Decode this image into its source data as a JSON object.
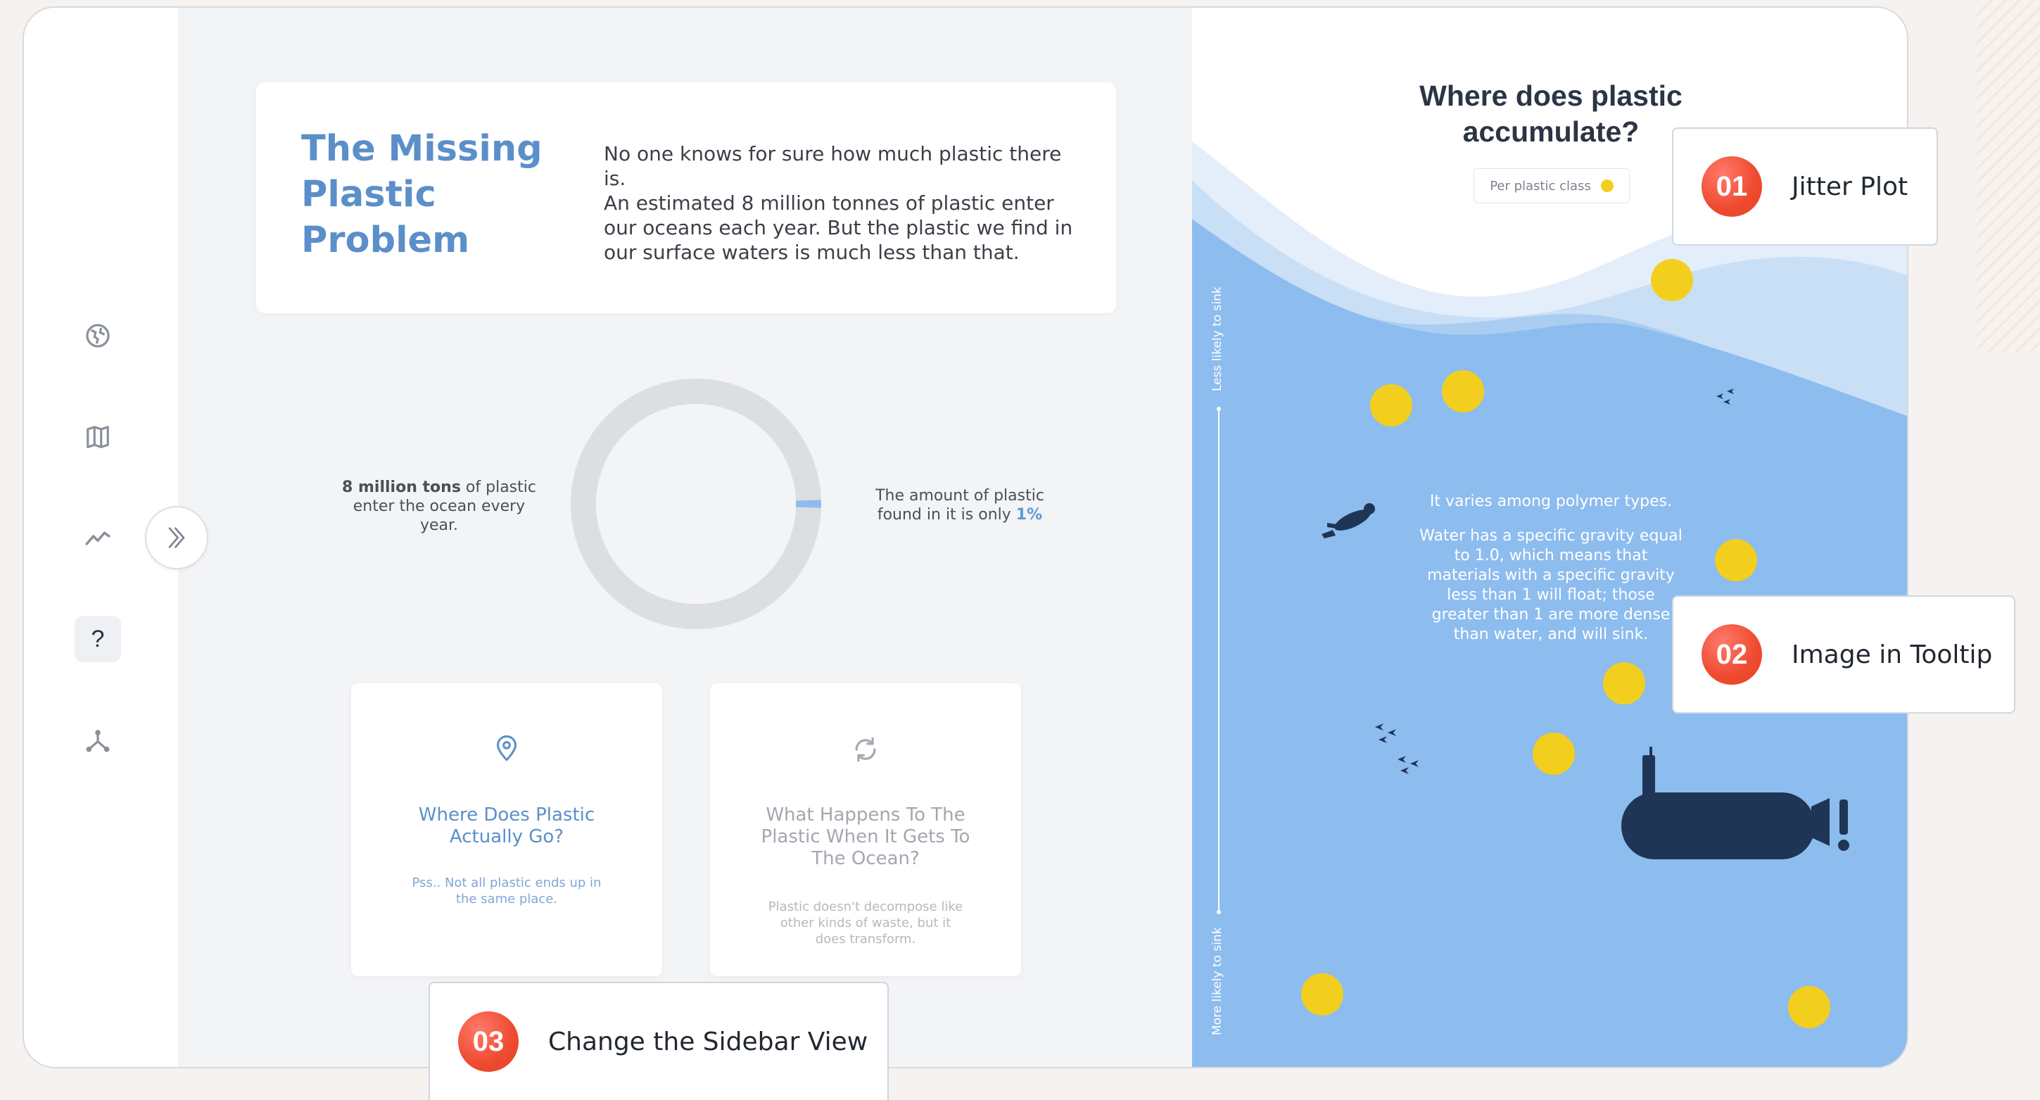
{
  "intro": {
    "title": "The Missing Plastic Problem",
    "p1": "No one knows for sure how much plastic there is.",
    "p2": "An estimated 8 million tonnes of plastic enter our oceans each year. But the plastic we find in our surface waters is much less than that."
  },
  "donut": {
    "left_bold": "8 million tons",
    "left_rest": " of plastic enter the ocean every year.",
    "right_text": "The amount of plastic found in it is only ",
    "right_pct": "1%",
    "fraction": 0.01
  },
  "cards": [
    {
      "title": "Where Does Plastic Actually Go?",
      "subtitle": "Pss.. Not all plastic ends up in the same place.",
      "icon": "location-pin-icon"
    },
    {
      "title": "What Happens To The Plastic When It Gets To The Ocean?",
      "subtitle": "Plastic doesn't decompose like other kinds of waste, but it does transform.",
      "icon": "refresh-icon"
    }
  ],
  "ocean": {
    "title": "Where does plastic accumulate?",
    "legend_label": "Per plastic class",
    "axis_top": "Less likely to sink",
    "axis_bottom": "More likely to sink",
    "text1": "It varies among polymer types.",
    "text2": "Water has a specific gravity equal to 1.0, which means that materials with a specific gravity less than 1 will float; those greater than 1 are more dense than water, and will sink."
  },
  "callouts": [
    {
      "number": "01",
      "label": "Jitter Plot"
    },
    {
      "number": "02",
      "label": "Image in Tooltip"
    },
    {
      "number": "03",
      "label": "Change the Sidebar View"
    }
  ],
  "sidebar": {
    "icons": [
      "globe-icon",
      "map-icon",
      "trend-icon",
      "help-icon",
      "network-icon"
    ],
    "help_glyph": "?"
  },
  "colors": {
    "accent": "#5b8fc9",
    "ocean": "#8dbcee",
    "plastic": "#f2cf1f",
    "submarine": "#1f3556",
    "badge": "#ee4a2f"
  }
}
